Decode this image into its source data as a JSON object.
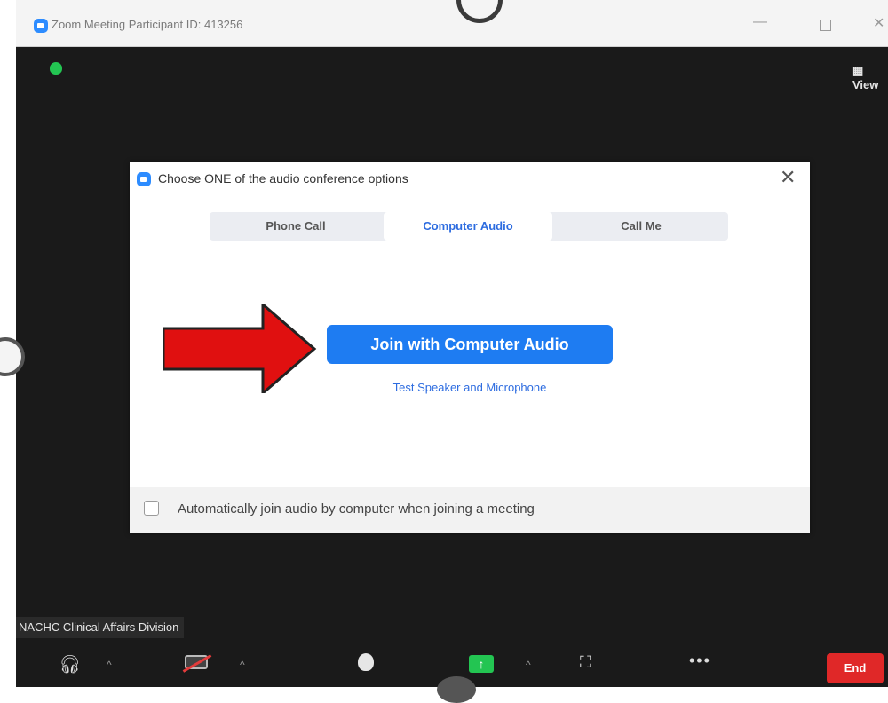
{
  "window": {
    "title": "Zoom Meeting Participant ID: 413256",
    "minimize_symbol": "—",
    "close_symbol": "✕"
  },
  "header": {
    "view_label": "View"
  },
  "dialog": {
    "title": "Choose ONE of the audio conference options",
    "close_symbol": "✕",
    "tabs": [
      {
        "label": "Phone Call"
      },
      {
        "label": "Computer Audio"
      },
      {
        "label": "Call Me"
      }
    ],
    "selected_tab": "Computer Audio",
    "join_button": "Join with Computer Audio",
    "test_link": "Test Speaker and Microphone",
    "auto_join_label": "Automatically join audio by computer when joining a meeting",
    "auto_join_checked": false
  },
  "participant": {
    "name": "NACHC Clinical Affairs Division"
  },
  "toolbar": {
    "caret_symbol": "^",
    "share_symbol": "↑",
    "record_symbol": "⛶",
    "more_symbol": "•••",
    "end_label": "End"
  },
  "colors": {
    "accent": "#1e7cf2",
    "share_green": "#23c552",
    "end_red": "#e02828",
    "arrow_red": "#e01010"
  }
}
